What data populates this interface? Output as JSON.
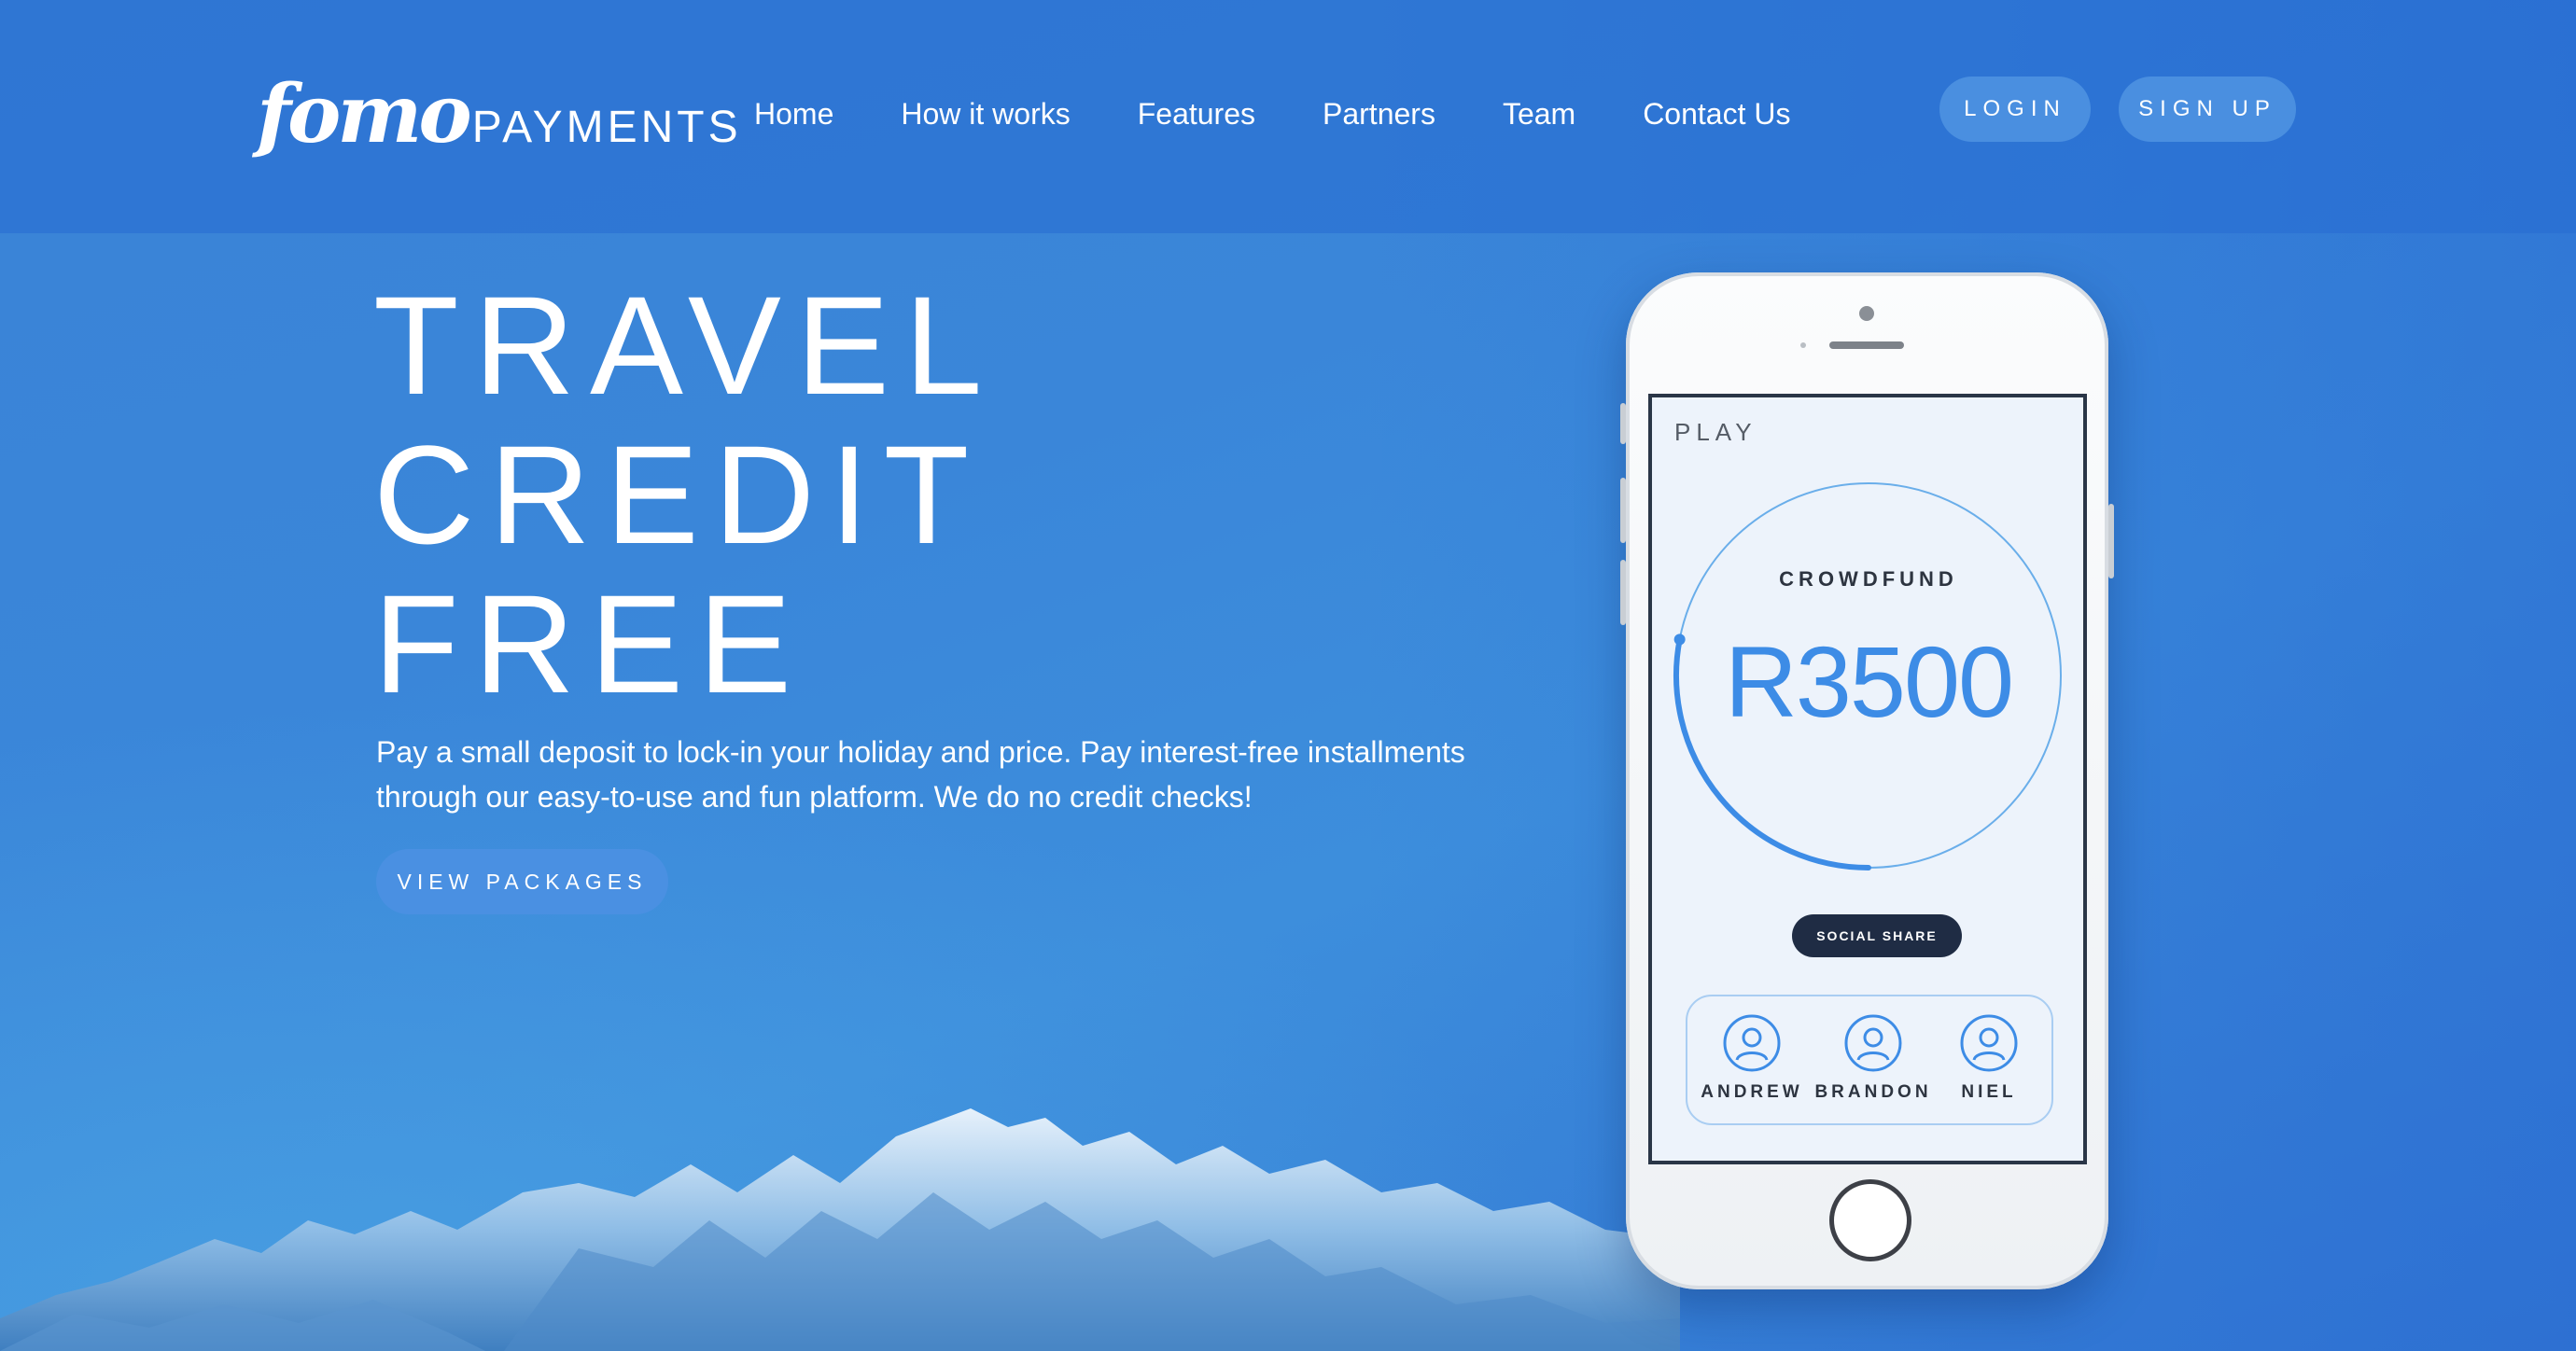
{
  "brand": {
    "script": "fomo",
    "word": "PAYMENTS"
  },
  "nav": {
    "items": [
      {
        "label": "Home"
      },
      {
        "label": "How it works"
      },
      {
        "label": "Features"
      },
      {
        "label": "Partners"
      },
      {
        "label": "Team"
      },
      {
        "label": "Contact Us"
      }
    ]
  },
  "auth": {
    "login_label": "LOGIN",
    "signup_label": "SIGN UP"
  },
  "hero": {
    "lines": [
      "TRAVEL",
      "CREDIT",
      "FREE"
    ],
    "description": "Pay a small deposit to lock-in your holiday and price. Pay interest-free installments through our easy-to-use and fun platform. We do no credit checks!",
    "cta_label": "VIEW PACKAGES"
  },
  "phone_app": {
    "screen_title": "PLAY",
    "ring_label": "CROWDFUND",
    "amount": "R3500",
    "progress_fraction": 0.2,
    "share_label": "SOCIAL SHARE",
    "friends": [
      {
        "name": "ANDREW",
        "icon": "user-icon"
      },
      {
        "name": "BRANDON",
        "icon": "user-icon"
      },
      {
        "name": "NIEL",
        "icon": "user-icon"
      }
    ]
  },
  "colors": {
    "background": "#3a86d9",
    "button": "#4a8fe0",
    "accent": "#3d8ce6",
    "dark_button": "#1f2c44"
  }
}
